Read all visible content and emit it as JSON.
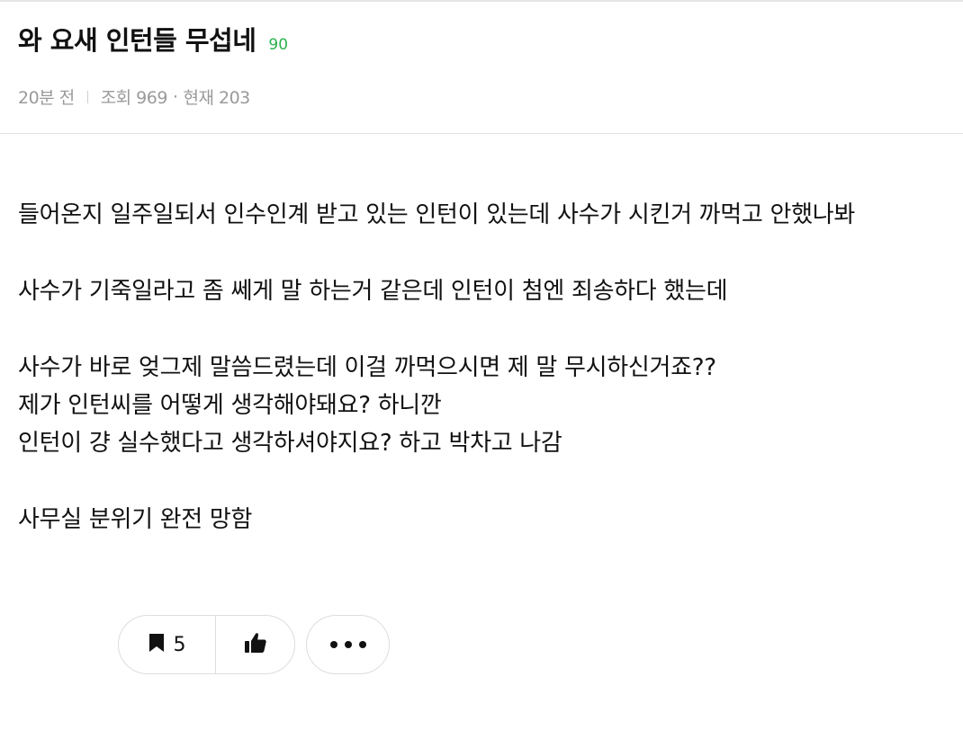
{
  "post": {
    "title": "와 요새 인턴들 무섭네",
    "comment_count": "90",
    "time_ago": "20분 전",
    "views": "조회 969",
    "current_viewers": "현재 203",
    "meta_dot": "·"
  },
  "content": {
    "lines": [
      "들어온지 일주일되서 인수인계 받고 있는 인턴이 있는데 사수가 시킨거 까먹고 안했나봐",
      "사수가 기죽일라고 좀 쎄게 말 하는거 같은데 인턴이 첨엔 죄송하다 했는데",
      "사수가 바로 엊그제 말씀드렸는데 이걸 까먹으시면 제 말 무시하신거죠??",
      "제가 인턴씨를 어떻게 생각해야돼요? 하니깐",
      "인턴이 걍 실수했다고 생각하셔야지요? 하고 박차고 나감",
      "사무실 분위기 완전 망함"
    ]
  },
  "actions": {
    "scrap_count": "5",
    "scrap_icon": "bookmark-icon",
    "like_icon": "thumbs-up-icon",
    "more_icon": "more-dots-icon"
  },
  "colors": {
    "comment_count": "#2bb34a",
    "meta_text": "#9a9a9a",
    "border": "#dddddd"
  }
}
